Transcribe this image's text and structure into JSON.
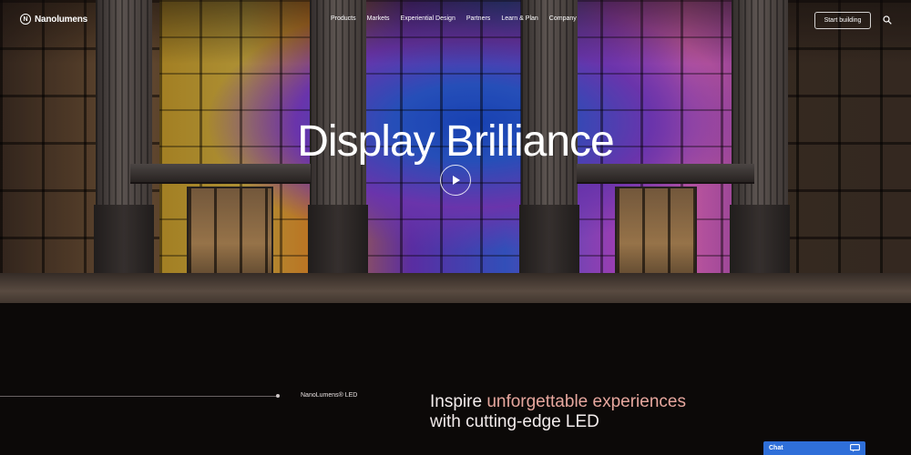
{
  "nav": {
    "logo": "Nanolumens",
    "logo_glyph": "N",
    "links": [
      "Products",
      "Markets",
      "Experiential Design",
      "Partners",
      "Learn & Plan",
      "Company"
    ],
    "cta": "Start building",
    "search_icon": "search-icon"
  },
  "hero": {
    "title": "Display Brilliance",
    "play_icon": "play-icon"
  },
  "section": {
    "eyebrow": "NanoLumens® LED",
    "headline_pre": "Inspire ",
    "headline_accent": "unforgettable experiences",
    "headline_post": " with cutting-edge LED"
  },
  "chat": {
    "label": "Chat",
    "icon": "chat-icon"
  },
  "colors": {
    "accent": "#e7a79e",
    "chat_bg": "#2f6fd9",
    "page_bg": "#0c0908"
  }
}
